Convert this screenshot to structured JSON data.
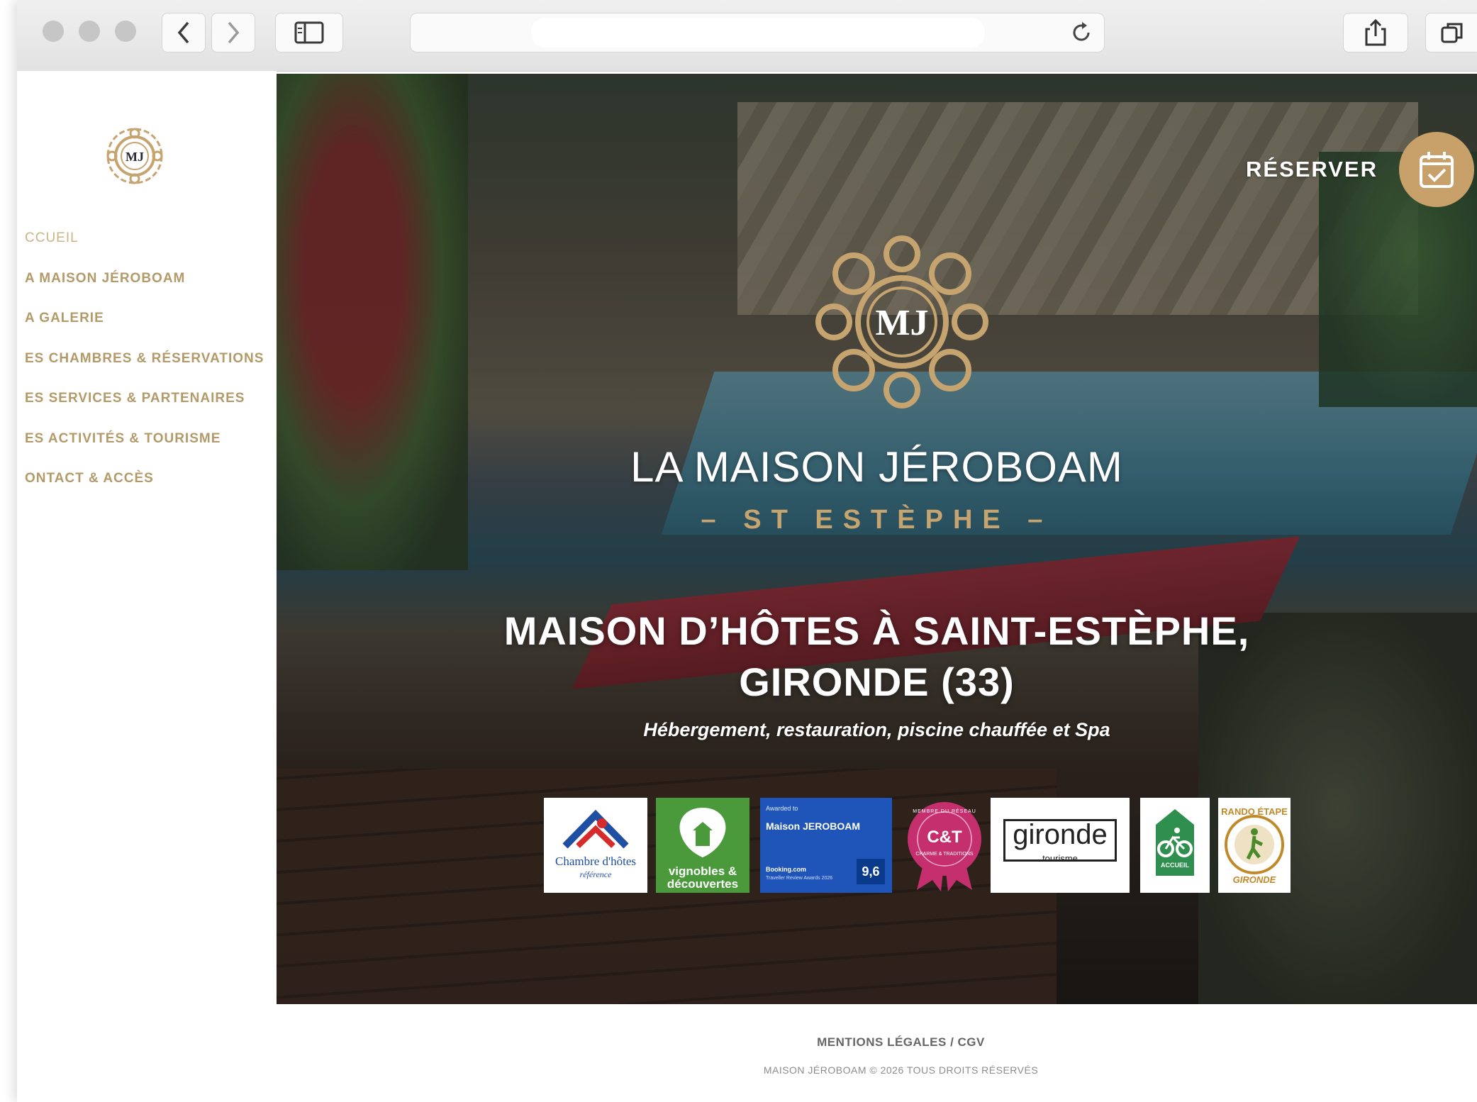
{
  "colors": {
    "gold": "#c6a46f",
    "nav_text": "#b39a68",
    "booking_blue": "#1f55b8",
    "vignobles_green": "#4a9a3c",
    "ct_pink": "#c62f6e"
  },
  "browser": {
    "back_icon": "chevron-left-icon",
    "forward_icon": "chevron-right-icon",
    "sidebar_icon": "sidebar-icon",
    "reload_icon": "reload-icon",
    "share_icon": "share-icon",
    "tabs_icon": "tabs-icon",
    "url": ""
  },
  "sidebar": {
    "logo_text": "MJ",
    "items": [
      {
        "label": "CCUEIL"
      },
      {
        "label": "A MAISON JÉROBOAM"
      },
      {
        "label": "A GALERIE"
      },
      {
        "label": "ES CHAMBRES & RÉSERVATIONS"
      },
      {
        "label": "ES SERVICES & PARTENAIRES"
      },
      {
        "label": "ES ACTIVITÉS & TOURISME"
      },
      {
        "label": "ONTACT & ACCÈS"
      }
    ]
  },
  "hero": {
    "reserve_label": "RÉSERVER",
    "reserve_icon": "calendar-check-icon",
    "emblem_text": "MJ",
    "brand_name": "LA MAISON JÉROBOAM",
    "brand_sub": "– ST ESTÈPHE –",
    "heading_line1": "MAISON D’HÔTES À SAINT-ESTÈPHE,",
    "heading_line2": "GIRONDE (33)",
    "tagline": "Hébergement, restauration, piscine chauffée et Spa"
  },
  "badges": {
    "chambre_line1": "Chambre d'hôtes",
    "chambre_line2": "référence",
    "vignobles_line1": "vignobles &",
    "vignobles_line2": "découvertes",
    "booking_small": "Awarded to",
    "booking_name": "Maison JEROBOAM",
    "booking_score": "9,6",
    "booking_brand": "Booking.com",
    "booking_award": "Traveller Review Awards 2026",
    "ct_logo": "C&T",
    "ct_ring": "MEMBRE DU RÉSEAU",
    "ct_sub": "CHARME & TRADITIONS",
    "gironde_name": "gironde",
    "gironde_sub": "tourisme",
    "accueil_label": "ACCUEIL",
    "rando_top": "RANDO ÉTAPE",
    "rando_bottom": "GIRONDE"
  },
  "footer": {
    "links": "MENTIONS LÉGALES / CGV",
    "copyright": "MAISON JÉROBOAM © 2026 TOUS DROITS RÉSERVÉS"
  }
}
